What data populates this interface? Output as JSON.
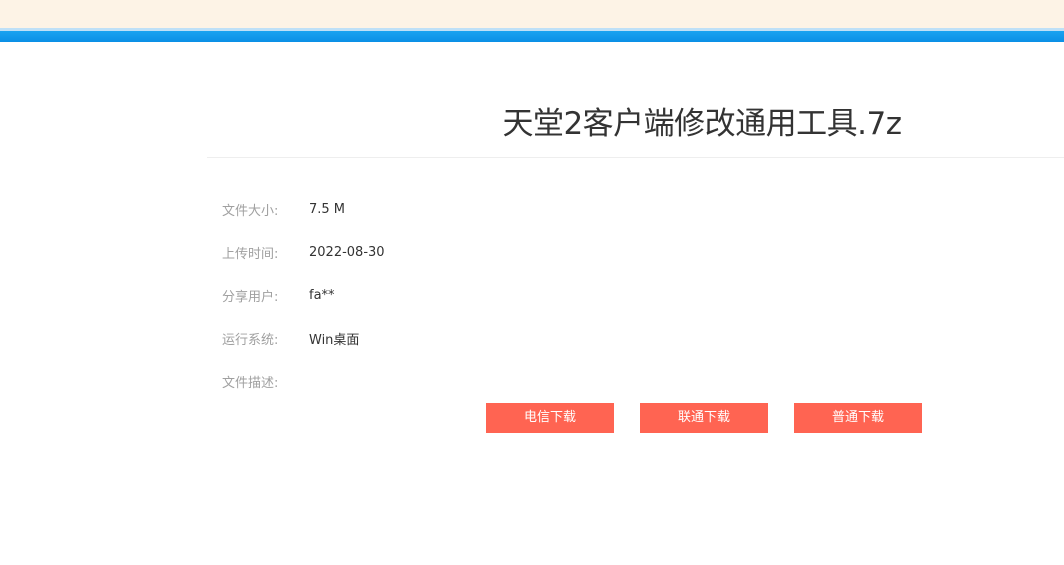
{
  "file": {
    "title": "天堂2客户端修改通用工具.7z"
  },
  "info": {
    "rows": [
      {
        "label": "文件大小:",
        "value": "7.5 M"
      },
      {
        "label": "上传时间:",
        "value": "2022-08-30"
      },
      {
        "label": "分享用户:",
        "value": "fa**"
      },
      {
        "label": "运行系统:",
        "value": "Win桌面"
      },
      {
        "label": "文件描述:",
        "value": ""
      }
    ]
  },
  "downloads": {
    "telecom_label": "电信下载",
    "unicom_label": "联通下载",
    "normal_label": "普通下载"
  },
  "colors": {
    "accent_blue": "#0a8fe6",
    "button_red": "#ff6452",
    "top_strip": "#fdf3e6"
  }
}
